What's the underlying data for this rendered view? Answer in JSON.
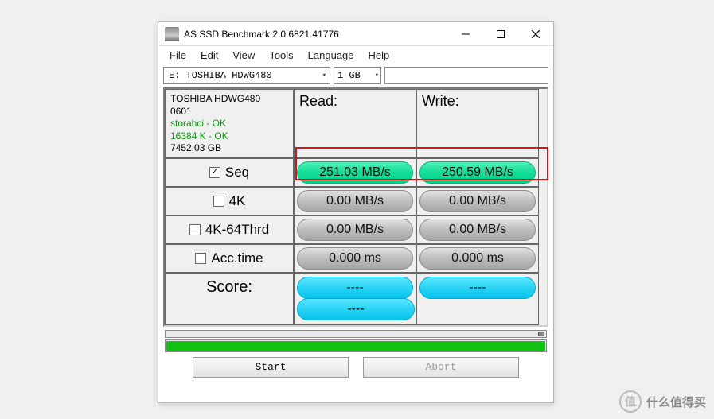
{
  "window": {
    "title": "AS SSD Benchmark 2.0.6821.41776"
  },
  "menu": {
    "file": "File",
    "edit": "Edit",
    "view": "View",
    "tools": "Tools",
    "language": "Language",
    "help": "Help"
  },
  "controls": {
    "drive": "E: TOSHIBA HDWG480",
    "size": "1 GB"
  },
  "info": {
    "model": "TOSHIBA HDWG480",
    "fw": "0601",
    "driver": "storahci - OK",
    "align": "16384 K - OK",
    "capacity": "7452.03 GB"
  },
  "headers": {
    "read": "Read:",
    "write": "Write:"
  },
  "tests": {
    "seq": {
      "label": "Seq",
      "checked": true,
      "read": "251.03 MB/s",
      "write": "250.59 MB/s"
    },
    "fourk": {
      "label": "4K",
      "checked": false,
      "read": "0.00 MB/s",
      "write": "0.00 MB/s"
    },
    "fourk64": {
      "label": "4K-64Thrd",
      "checked": false,
      "read": "0.00 MB/s",
      "write": "0.00 MB/s"
    },
    "acc": {
      "label": "Acc.time",
      "checked": false,
      "read": "0.000 ms",
      "write": "0.000 ms"
    }
  },
  "score": {
    "label": "Score:",
    "read": "----",
    "write": "----",
    "total": "----"
  },
  "buttons": {
    "start": "Start",
    "abort": "Abort"
  },
  "watermark": {
    "symbol": "值",
    "text": "什么值得买"
  }
}
